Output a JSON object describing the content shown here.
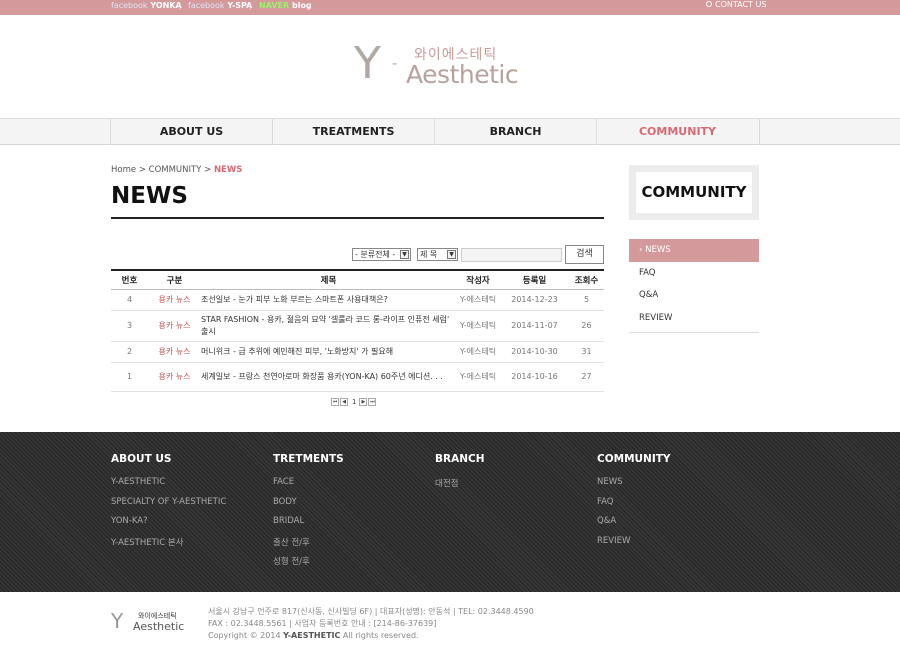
{
  "topbar": {
    "links": [
      {
        "brand": "facebook",
        "name": "YONKA"
      },
      {
        "brand": "facebook",
        "name": "Y-SPA"
      },
      {
        "brand": "NAVER",
        "name": "blog"
      }
    ],
    "separator": "|",
    "contact": "CONTACT US",
    "colors": {
      "bar": "#d4999b"
    }
  },
  "logo": {
    "letter": "Y",
    "dash": "-",
    "korean": "와이에스테틱",
    "english": "Aesthetic"
  },
  "nav": {
    "items": [
      {
        "label": "ABOUT US"
      },
      {
        "label": "TREATMENTS"
      },
      {
        "label": "BRANCH"
      },
      {
        "label": "COMMUNITY",
        "active": true
      }
    ]
  },
  "breadcrumb": {
    "home": "Home",
    "sep": ">",
    "section": "COMMUNITY",
    "current": "NEWS"
  },
  "page_title": "NEWS",
  "search": {
    "category_select": "- 분류전체 -",
    "field_select": "제 목",
    "query": "",
    "button": "검색"
  },
  "board": {
    "headers": [
      "번호",
      "구분",
      "제목",
      "작성자",
      "등록일",
      "조회수"
    ],
    "rows": [
      {
        "no": "4",
        "cat": "용카 뉴스",
        "subject": "조선일보 - 눈가 피부 노화 부르는 스마트폰 사용대책은?",
        "author": "Y-에스테틱",
        "date": "2014-12-23",
        "views": "5"
      },
      {
        "no": "3",
        "cat": "용카 뉴스",
        "subject": "STAR FASHION - 용카, 젊음의 묘약 '셀룰라 코드 롱-라이프 인퓨전 세럼' 출시",
        "author": "Y-에스테틱",
        "date": "2014-11-07",
        "views": "26"
      },
      {
        "no": "2",
        "cat": "용카 뉴스",
        "subject": "머니위크 - 급 추위에 예민해진 피부, '노화방지' 가 필요해",
        "author": "Y-에스테틱",
        "date": "2014-10-30",
        "views": "31"
      },
      {
        "no": "1",
        "cat": "용카 뉴스",
        "subject": "세계일보 - 프랑스 천연아로마 화장품 용카(YON-KA) 60주년 에디션. . .",
        "author": "Y-에스테틱",
        "date": "2014-10-16",
        "views": "27"
      }
    ]
  },
  "paging": {
    "current": "1"
  },
  "sidebar": {
    "title": "COMMUNITY",
    "items": [
      {
        "label": "NEWS",
        "active": true
      },
      {
        "label": "FAQ"
      },
      {
        "label": "Q&A"
      },
      {
        "label": "REVIEW"
      }
    ]
  },
  "footer": {
    "columns": [
      {
        "title": "ABOUT US",
        "links": [
          "Y-AESTHETIC",
          "SPECIALTY OF Y-AESTHETIC",
          "YON-KA?",
          "Y-AESTHETIC 본사"
        ]
      },
      {
        "title": "TRETMENTS",
        "links": [
          "FACE",
          "BODY",
          "BRIDAL",
          "출산 전/후",
          "성형 전/후"
        ]
      },
      {
        "title": "BRANCH",
        "links": [
          "대전점"
        ]
      },
      {
        "title": "COMMUNITY",
        "links": [
          "NEWS",
          "FAQ",
          "Q&A",
          "REVIEW"
        ]
      }
    ],
    "logo": {
      "letter": "Y",
      "korean": "와이에스테틱",
      "english": "Aesthetic"
    },
    "address_line": "서울시 강남구 언주로 817(신사동, 신사빌딩 6F) | 대표자(성명): 안동석 | TEL: 02.3448.4590",
    "fax_line": "FAX : 02.3448.5561 | 사업자 등록번호 안내 : [214-86-37639]",
    "copyright_prefix": "Copyright © 2014",
    "copyright_brand": "Y-AESTHETIC",
    "copyright_suffix": "All rights reserved."
  }
}
